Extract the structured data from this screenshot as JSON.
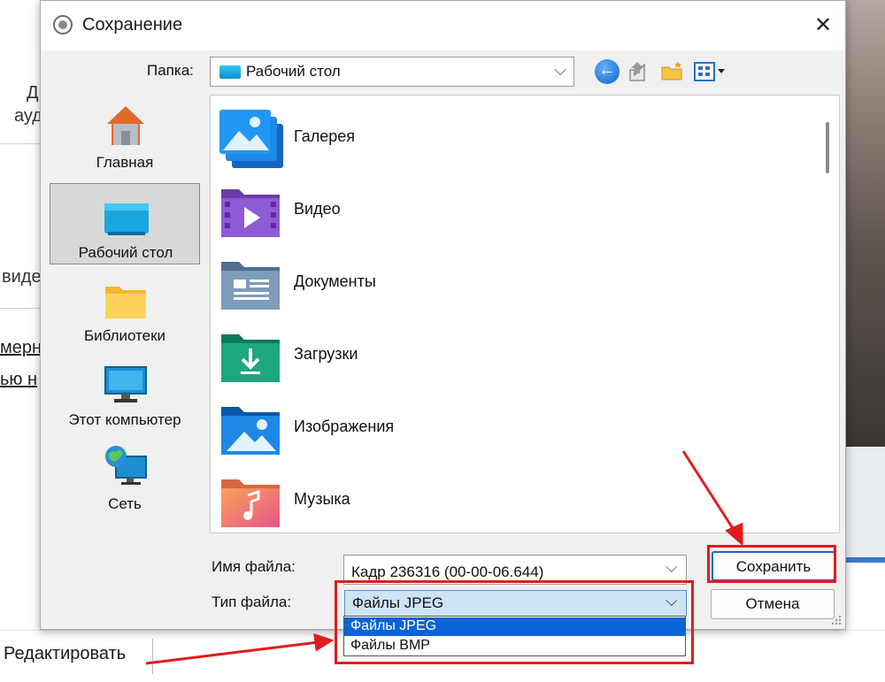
{
  "background": {
    "text_fragments": [
      "Д",
      "ауд",
      "виде",
      "мерн",
      "ью н"
    ],
    "edit_label": "Редактировать"
  },
  "dialog": {
    "title": "Сохранение",
    "close_glyph": "✕",
    "folder": {
      "label": "Папка:",
      "value": "Рабочий стол",
      "dropdown_glyph": "⌵"
    },
    "places": [
      {
        "label": "Главная",
        "icon": "home-icon"
      },
      {
        "label": "Рабочий стол",
        "icon": "desktop-icon",
        "selected": true
      },
      {
        "label": "Библиотеки",
        "icon": "folder-icon"
      },
      {
        "label": "Этот компьютер",
        "icon": "computer-icon"
      },
      {
        "label": "Сеть",
        "icon": "network-icon"
      }
    ],
    "files": [
      {
        "name": "Галерея",
        "icon": "gallery-icon"
      },
      {
        "name": "Видео",
        "icon": "video-folder-icon"
      },
      {
        "name": "Документы",
        "icon": "documents-folder-icon"
      },
      {
        "name": "Загрузки",
        "icon": "downloads-folder-icon"
      },
      {
        "name": "Изображения",
        "icon": "pictures-folder-icon"
      },
      {
        "name": "Музыка",
        "icon": "music-folder-icon"
      }
    ],
    "filename": {
      "label": "Имя файла:",
      "value": "Кадр 236316 (00-00-06.644)"
    },
    "filetype": {
      "label": "Тип файла:",
      "selected": "Файлы JPEG",
      "options": [
        "Файлы JPEG",
        "Файлы BMP"
      ]
    },
    "buttons": {
      "save": "Сохранить",
      "cancel": "Отмена"
    }
  },
  "colors": {
    "annotation": "#e21b1b",
    "selection": "#0a64d6",
    "select_bg": "#cde4f7"
  }
}
